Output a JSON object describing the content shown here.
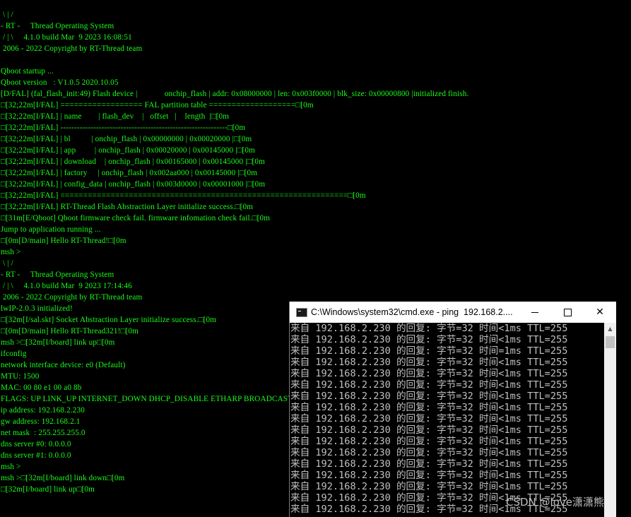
{
  "terminal": {
    "lines": [
      " \\ | /",
      "- RT -     Thread Operating System",
      " / | \\     4.1.0 build Mar  9 2023 16:08:51",
      " 2006 - 2022 Copyright by RT-Thread team",
      "",
      "Qboot startup ...",
      "Qboot version   : V1.0.5 2020.10.05",
      "[D/FAL] (fal_flash_init:49) Flash device |             onchip_flash | addr: 0x08000000 | len: 0x003f0000 | blk_size: 0x00000800 |initialized finish.",
      "□[32;22m[I/FAL] ================== FAL partition table ===================□[0m",
      "□[32;22m[I/FAL] | name        | flash_dev    |   offset   |    length  |□[0m",
      "□[32;22m[I/FAL] -------------------------------------------------------------□[0m",
      "□[32;22m[I/FAL] | bl          | onchip_flash | 0x00000000 | 0x00020000 |□[0m",
      "□[32;22m[I/FAL] | app         | onchip_flash | 0x00020000 | 0x00145000 |□[0m",
      "□[32;22m[I/FAL] | download    | onchip_flash | 0x00165000 | 0x00145000 |□[0m",
      "□[32;22m[I/FAL] | factory     | onchip_flash | 0x002aa000 | 0x00145000 |□[0m",
      "□[32;22m[I/FAL] | config_data | onchip_flash | 0x003d0000 | 0x00001000 |□[0m",
      "□[32;22m[I/FAL] ===============================================================□[0m",
      "□[32;22m[I/FAL] RT-Thread Flash Abstraction Layer initialize success.□[0m",
      "□[31m[E/Qboot] Qboot firmware check fail. firmware infomation check fail.□[0m",
      "Jump to application running ...",
      "□[0m[D/main] Hello RT-Thread!□[0m",
      "msh >",
      " \\ | /",
      "- RT -     Thread Operating System",
      " / | \\     4.1.0 build Mar  9 2023 17:14:46",
      " 2006 - 2022 Copyright by RT-Thread team",
      "lwIP-2.0.3 initialized!",
      "□[32m[I/sal.skt] Socket Abstraction Layer initialize success.□[0m",
      "□[0m[D/main] Hello RT-Thread321!□[0m",
      "msh >□[32m[I/board] link up□[0m",
      "ifconfig",
      "network interface device: e0 (Default)",
      "MTU: 1500",
      "MAC: 00 80 e1 00 a0 8b",
      "FLAGS: UP LINK_UP INTERNET_DOWN DHCP_DISABLE ETHARP BROADCAST IGMP",
      "ip address: 192.168.2.230",
      "gw address: 192.168.2.1",
      "net mask  : 255.255.255.0",
      "dns server #0: 0.0.0.0",
      "dns server #1: 0.0.0.0",
      "msh >",
      "msh >□[32m[I/board] link down□[0m",
      "□[32m[I/board] link up□[0m"
    ]
  },
  "cmd_window": {
    "title": "C:\\Windows\\system32\\cmd.exe - ping  192.168.2....",
    "icon": "cmd-app-icon",
    "buttons": {
      "minimize": "minimize-icon",
      "maximize": "maximize-icon",
      "close": "✕"
    },
    "lines": [
      "来自 192.168.2.230 的回复: 字节=32 时间<1ms TTL=255",
      "来自 192.168.2.230 的回复: 字节=32 时间<1ms TTL=255",
      "来自 192.168.2.230 的回复: 字节=32 时间=1ms TTL=255",
      "来自 192.168.2.230 的回复: 字节=32 时间<1ms TTL=255",
      "来自 192.168.2.230 的回复: 字节=32 时间<1ms TTL=255",
      "来自 192.168.2.230 的回复: 字节=32 时间<1ms TTL=255",
      "来自 192.168.2.230 的回复: 字节=32 时间<1ms TTL=255",
      "来自 192.168.2.230 的回复: 字节=32 时间<1ms TTL=255",
      "来自 192.168.2.230 的回复: 字节=32 时间<1ms TTL=255",
      "来自 192.168.2.230 的回复: 字节=32 时间<1ms TTL=255",
      "来自 192.168.2.230 的回复: 字节=32 时间<1ms TTL=255",
      "来自 192.168.2.230 的回复: 字节=32 时间<1ms TTL=255",
      "来自 192.168.2.230 的回复: 字节=32 时间<1ms TTL=255",
      "来自 192.168.2.230 的回复: 字节=32 时间<1ms TTL=255",
      "来自 192.168.2.230 的回复: 字节=32 时间<1ms TTL=255",
      "来自 192.168.2.230 的回复: 字节=32 时间<1ms TTL=255",
      "来自 192.168.2.230 的回复: 字节=32 时间<1ms TTL=255"
    ]
  },
  "watermark": "CSDN @love潇潇熊",
  "colors": {
    "terminal_bg": "#000000",
    "terminal_fg": "#18ff18",
    "cmd_fg": "#c0c0c0",
    "titlebar_bg": "#ffffff"
  }
}
